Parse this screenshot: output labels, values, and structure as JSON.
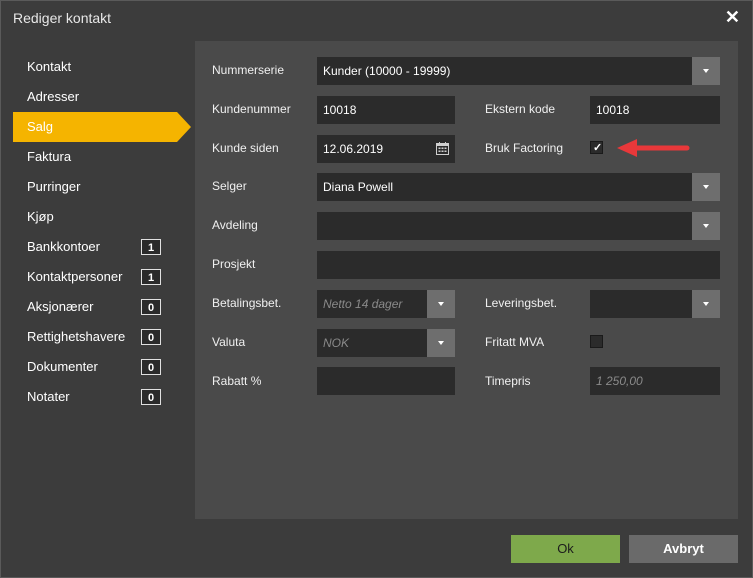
{
  "window": {
    "title": "Rediger kontakt"
  },
  "sidebar": {
    "items": [
      {
        "label": "Kontakt"
      },
      {
        "label": "Adresser"
      },
      {
        "label": "Salg",
        "active": true
      },
      {
        "label": "Faktura"
      },
      {
        "label": "Purringer"
      },
      {
        "label": "Kjøp"
      },
      {
        "label": "Bankkontoer",
        "count": "1"
      },
      {
        "label": "Kontaktpersoner",
        "count": "1"
      },
      {
        "label": "Aksjonærer",
        "count": "0"
      },
      {
        "label": "Rettighetshavere",
        "count": "0"
      },
      {
        "label": "Dokumenter",
        "count": "0"
      },
      {
        "label": "Notater",
        "count": "0"
      }
    ]
  },
  "form": {
    "nummerserie": {
      "label": "Nummerserie",
      "value": "Kunder (10000 - 19999)"
    },
    "kundenummer": {
      "label": "Kundenummer",
      "value": "10018"
    },
    "ekstern_kode": {
      "label": "Ekstern kode",
      "value": "10018"
    },
    "kunde_siden": {
      "label": "Kunde siden",
      "value": "12.06.2019"
    },
    "bruk_factoring": {
      "label": "Bruk Factoring",
      "checked": true,
      "mark": "✓"
    },
    "selger": {
      "label": "Selger",
      "value": "Diana Powell"
    },
    "avdeling": {
      "label": "Avdeling",
      "value": ""
    },
    "prosjekt": {
      "label": "Prosjekt",
      "value": ""
    },
    "betalingsbet": {
      "label": "Betalingsbet.",
      "placeholder": "Netto 14 dager"
    },
    "leveringsbet": {
      "label": "Leveringsbet.",
      "value": ""
    },
    "valuta": {
      "label": "Valuta",
      "placeholder": "NOK"
    },
    "fritatt_mva": {
      "label": "Fritatt MVA",
      "checked": false
    },
    "rabatt": {
      "label": "Rabatt %",
      "value": ""
    },
    "timepris": {
      "label": "Timepris",
      "placeholder": "1 250,00"
    }
  },
  "footer": {
    "ok_label": "Ok",
    "cancel_label": "Avbryt"
  },
  "colors": {
    "accent": "#f5b400",
    "ok": "#7ea94b",
    "arrow": "#e8383a"
  },
  "icons": {
    "close": "close-icon",
    "calendar": "calendar-icon",
    "dropdown": "chevron-down-icon"
  }
}
